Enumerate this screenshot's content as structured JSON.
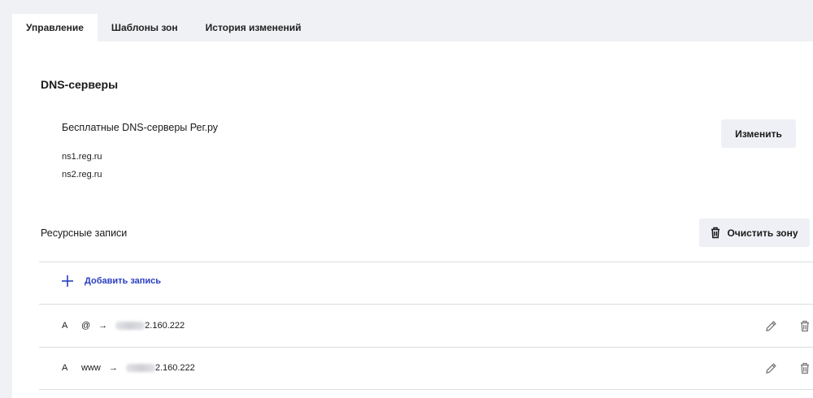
{
  "tabs": [
    {
      "label": "Управление",
      "active": true
    },
    {
      "label": "Шаблоны зон",
      "active": false
    },
    {
      "label": "История изменений",
      "active": false
    }
  ],
  "dns": {
    "title": "DNS-серверы",
    "provider_name": "Бесплатные DNS-серверы Рег.ру",
    "servers": [
      "ns1.reg.ru",
      "ns2.reg.ru"
    ],
    "change_button": "Изменить"
  },
  "resource_records": {
    "title": "Ресурсные записи",
    "clear_button": "Очистить зону",
    "add_record": "Добавить запись",
    "records": [
      {
        "type": "A",
        "host": "@",
        "arrow": "→",
        "ip_visible": "2.160.222"
      },
      {
        "type": "A",
        "host": "www",
        "arrow": "→",
        "ip_visible": "2.160.222"
      }
    ]
  },
  "icons": {
    "trash": "trash-icon",
    "plus": "plus-icon",
    "edit": "pencil-icon"
  },
  "colors": {
    "accent": "#2b3fc0",
    "background": "#f0f1f5",
    "panel": "#ffffff",
    "button_bg": "#eef0f5"
  }
}
